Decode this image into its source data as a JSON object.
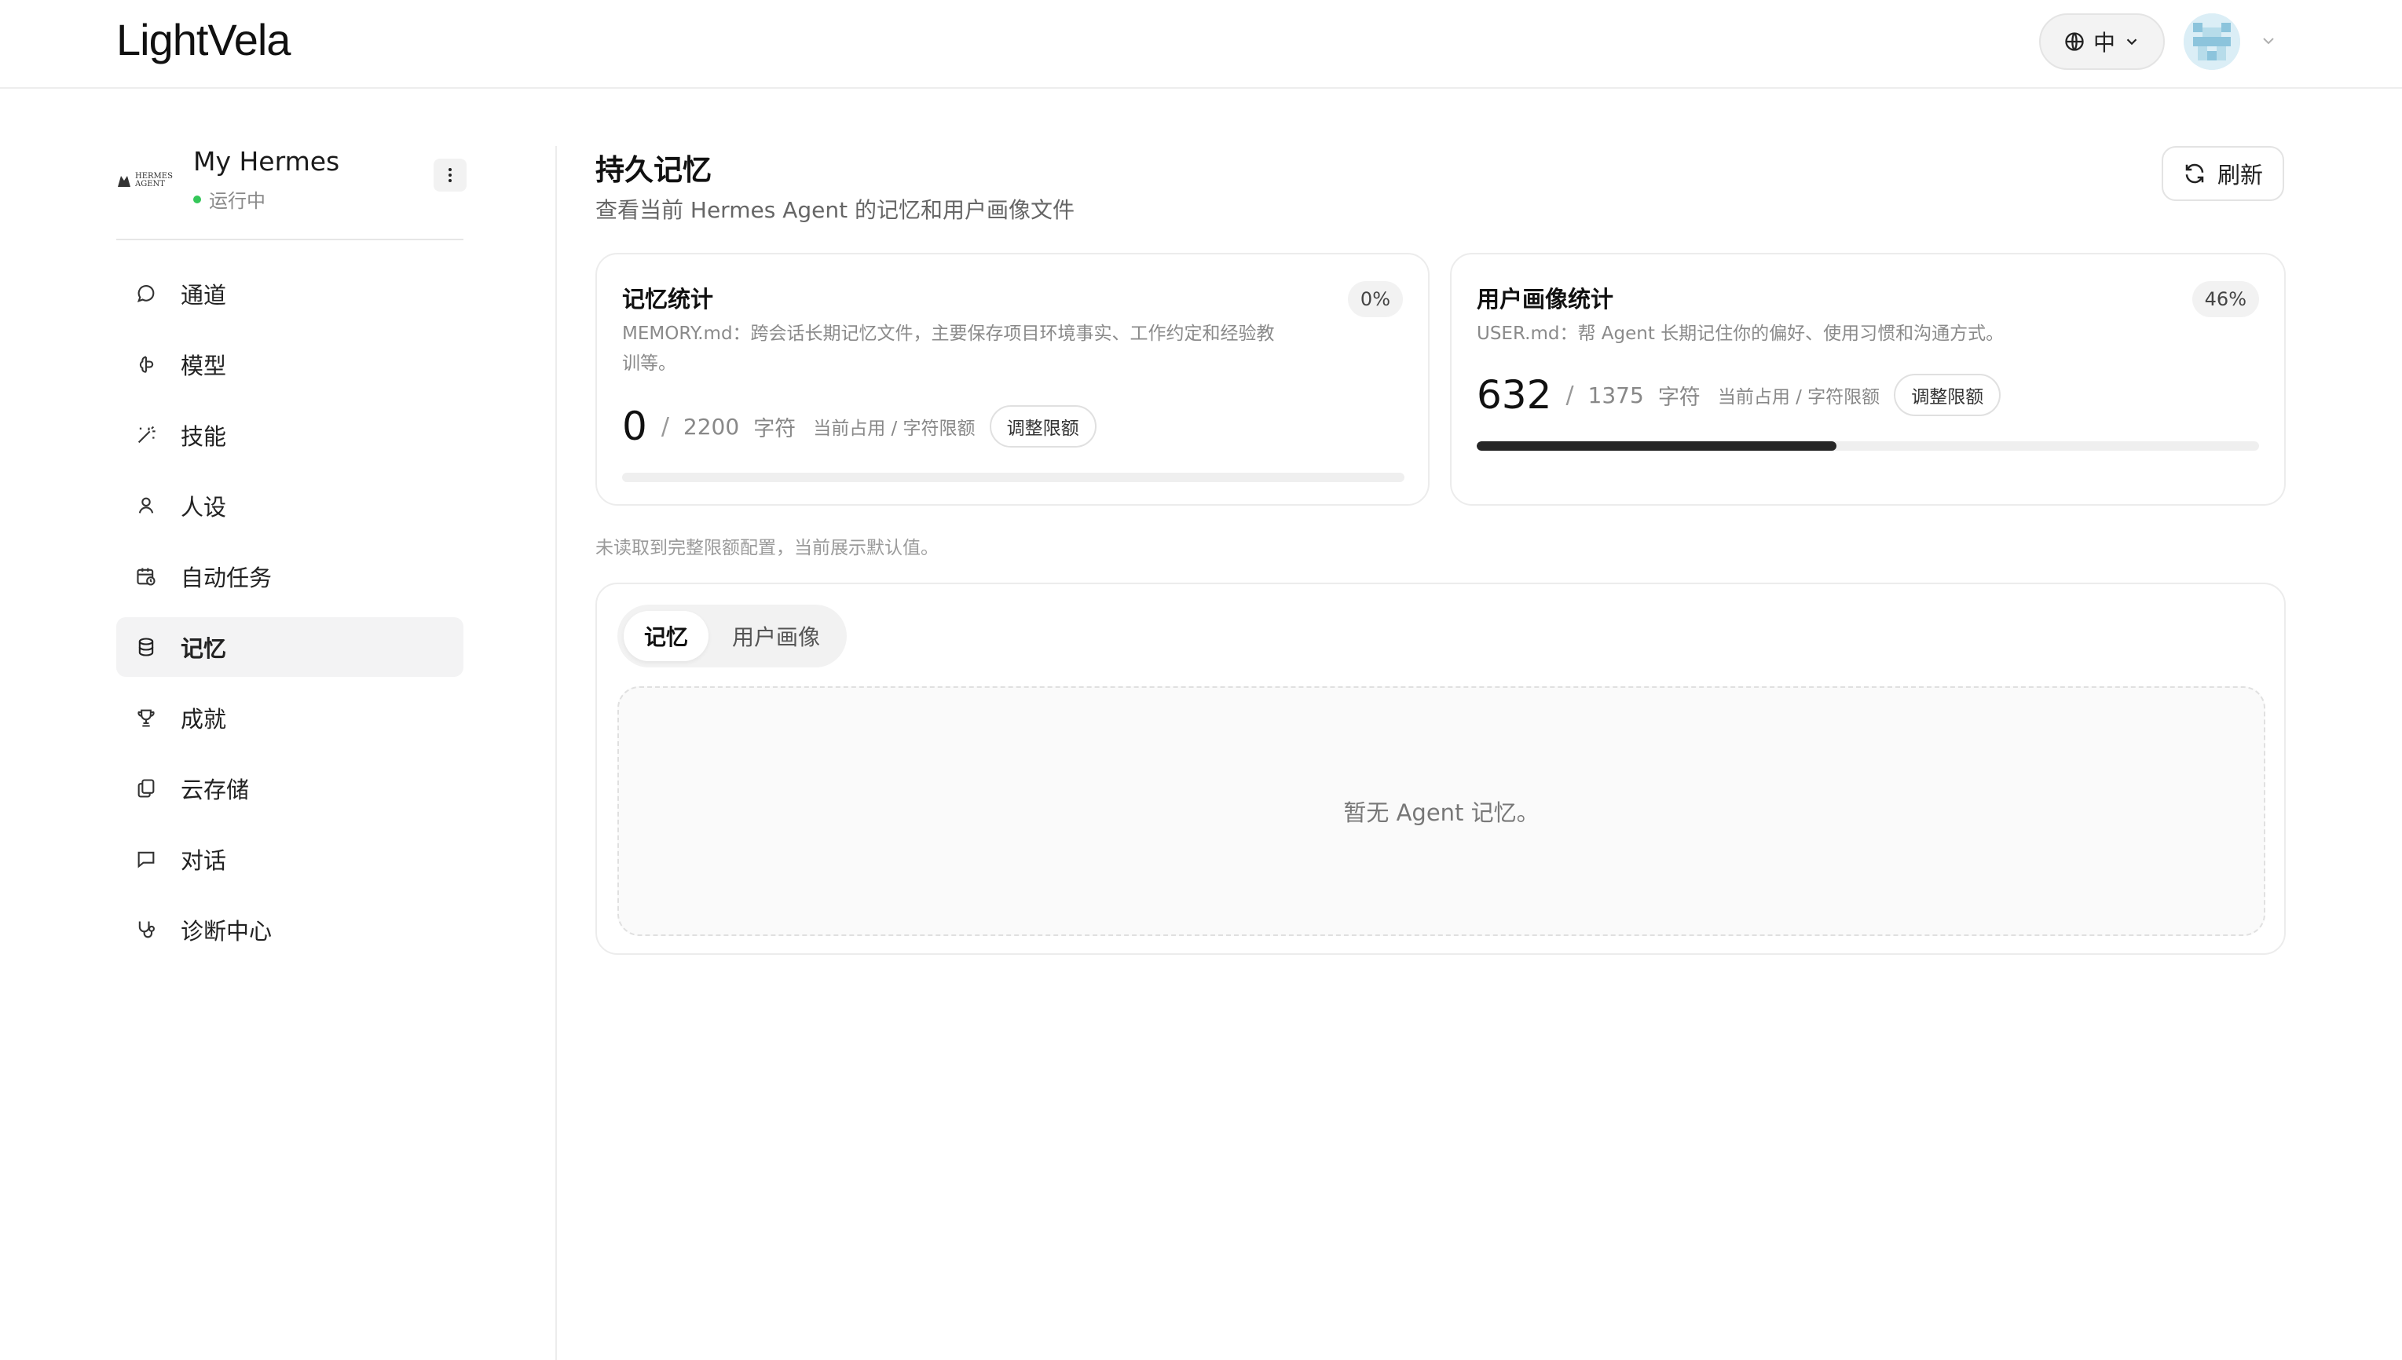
{
  "header": {
    "logo": "LightVela",
    "language": "中"
  },
  "agent": {
    "name": "My Hermes",
    "status": "运行中",
    "logo_text": "HERMES AGENT"
  },
  "sidebar": {
    "items": [
      {
        "label": "通道",
        "icon": "message-circle-icon",
        "active": false
      },
      {
        "label": "模型",
        "icon": "brain-icon",
        "active": false
      },
      {
        "label": "技能",
        "icon": "magic-wand-icon",
        "active": false
      },
      {
        "label": "人设",
        "icon": "user-icon",
        "active": false
      },
      {
        "label": "自动任务",
        "icon": "calendar-clock-icon",
        "active": false
      },
      {
        "label": "记忆",
        "icon": "database-icon",
        "active": true
      },
      {
        "label": "成就",
        "icon": "trophy-icon",
        "active": false
      },
      {
        "label": "云存储",
        "icon": "copy-files-icon",
        "active": false
      },
      {
        "label": "对话",
        "icon": "chat-square-icon",
        "active": false
      },
      {
        "label": "诊断中心",
        "icon": "stethoscope-icon",
        "active": false
      }
    ]
  },
  "main": {
    "title": "持久记忆",
    "subtitle": "查看当前 Hermes Agent 的记忆和用户画像文件",
    "refresh_label": "刷新",
    "memory_card": {
      "title": "记忆统计",
      "percent": "0%",
      "description_line1": "MEMORY.md：跨会话长期记忆文件，主要保存项目环境事实、工作约定和经验教",
      "description_line2": "训等。",
      "used": "0",
      "separator": "/",
      "limit": "2200",
      "unit": "字符",
      "hint": "当前占用 / 字符限额",
      "adjust_label": "调整限额",
      "progress": 0.0
    },
    "user_card": {
      "title": "用户画像统计",
      "percent": "46%",
      "description": "USER.md：帮 Agent 长期记住你的偏好、使用习惯和沟通方式。",
      "used": "632",
      "separator": "/",
      "limit": "1375",
      "unit": "字符",
      "hint": "当前占用 / 字符限额",
      "adjust_label": "调整限额",
      "progress": 0.46
    },
    "notice": "未读取到完整限额配置，当前展示默认值。",
    "tabs": [
      {
        "label": "记忆",
        "active": true
      },
      {
        "label": "用户画像",
        "active": false
      }
    ],
    "empty_text": "暂无 Agent 记忆。"
  }
}
